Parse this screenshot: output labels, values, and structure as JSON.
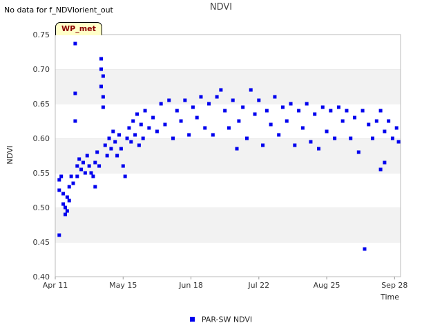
{
  "header": {
    "status_text": "No data for f_NDVIorient_out",
    "site_label": "WP_met"
  },
  "chart_data": {
    "type": "scatter",
    "title": "NDVI",
    "xlabel": "Time",
    "ylabel": "NDVI",
    "ylim": [
      0.4,
      0.75
    ],
    "xlim": [
      "2023-04-11",
      "2023-10-01"
    ],
    "y_ticks": [
      "0.40",
      "0.45",
      "0.50",
      "0.55",
      "0.60",
      "0.65",
      "0.70",
      "0.75"
    ],
    "x_ticks": [
      {
        "label": "Apr 11",
        "date": "2023-04-11"
      },
      {
        "label": "May 15",
        "date": "2023-05-15"
      },
      {
        "label": "Jun 18",
        "date": "2023-06-18"
      },
      {
        "label": "Jul 22",
        "date": "2023-07-22"
      },
      {
        "label": "Aug 25",
        "date": "2023-08-25"
      },
      {
        "label": "Sep 28",
        "date": "2023-09-28"
      }
    ],
    "grid": "alternating horizontal bands",
    "legend_position": "bottom-center",
    "series": [
      {
        "name": "PAR-SW NDVI",
        "color": "#0000ee",
        "points": [
          [
            "2023-04-13",
            0.46
          ],
          [
            "2023-04-13",
            0.54
          ],
          [
            "2023-04-13",
            0.525
          ],
          [
            "2023-04-14",
            0.545
          ],
          [
            "2023-04-15",
            0.505
          ],
          [
            "2023-04-15",
            0.52
          ],
          [
            "2023-04-16",
            0.49
          ],
          [
            "2023-04-16",
            0.5
          ],
          [
            "2023-04-17",
            0.495
          ],
          [
            "2023-04-17",
            0.515
          ],
          [
            "2023-04-18",
            0.53
          ],
          [
            "2023-04-18",
            0.51
          ],
          [
            "2023-04-19",
            0.545
          ],
          [
            "2023-04-20",
            0.535
          ],
          [
            "2023-04-21",
            0.737
          ],
          [
            "2023-04-21",
            0.665
          ],
          [
            "2023-04-21",
            0.625
          ],
          [
            "2023-04-22",
            0.56
          ],
          [
            "2023-04-22",
            0.545
          ],
          [
            "2023-04-23",
            0.57
          ],
          [
            "2023-04-24",
            0.555
          ],
          [
            "2023-04-25",
            0.565
          ],
          [
            "2023-04-26",
            0.55
          ],
          [
            "2023-04-27",
            0.575
          ],
          [
            "2023-04-28",
            0.56
          ],
          [
            "2023-04-29",
            0.55
          ],
          [
            "2023-04-30",
            0.545
          ],
          [
            "2023-05-01",
            0.53
          ],
          [
            "2023-05-01",
            0.565
          ],
          [
            "2023-05-02",
            0.58
          ],
          [
            "2023-05-03",
            0.56
          ],
          [
            "2023-05-04",
            0.715
          ],
          [
            "2023-05-04",
            0.7
          ],
          [
            "2023-05-04",
            0.675
          ],
          [
            "2023-05-05",
            0.69
          ],
          [
            "2023-05-05",
            0.66
          ],
          [
            "2023-05-05",
            0.645
          ],
          [
            "2023-05-06",
            0.59
          ],
          [
            "2023-05-07",
            0.575
          ],
          [
            "2023-05-08",
            0.6
          ],
          [
            "2023-05-09",
            0.585
          ],
          [
            "2023-05-10",
            0.61
          ],
          [
            "2023-05-11",
            0.595
          ],
          [
            "2023-05-12",
            0.575
          ],
          [
            "2023-05-13",
            0.605
          ],
          [
            "2023-05-14",
            0.585
          ],
          [
            "2023-05-15",
            0.56
          ],
          [
            "2023-05-16",
            0.545
          ],
          [
            "2023-05-17",
            0.6
          ],
          [
            "2023-05-18",
            0.615
          ],
          [
            "2023-05-19",
            0.595
          ],
          [
            "2023-05-20",
            0.625
          ],
          [
            "2023-05-21",
            0.605
          ],
          [
            "2023-05-22",
            0.635
          ],
          [
            "2023-05-23",
            0.59
          ],
          [
            "2023-05-24",
            0.62
          ],
          [
            "2023-05-25",
            0.6
          ],
          [
            "2023-05-26",
            0.64
          ],
          [
            "2023-05-28",
            0.615
          ],
          [
            "2023-05-30",
            0.63
          ],
          [
            "2023-06-01",
            0.61
          ],
          [
            "2023-06-03",
            0.65
          ],
          [
            "2023-06-05",
            0.62
          ],
          [
            "2023-06-07",
            0.655
          ],
          [
            "2023-06-09",
            0.6
          ],
          [
            "2023-06-11",
            0.64
          ],
          [
            "2023-06-13",
            0.625
          ],
          [
            "2023-06-15",
            0.655
          ],
          [
            "2023-06-17",
            0.605
          ],
          [
            "2023-06-19",
            0.645
          ],
          [
            "2023-06-21",
            0.63
          ],
          [
            "2023-06-23",
            0.66
          ],
          [
            "2023-06-25",
            0.615
          ],
          [
            "2023-06-27",
            0.65
          ],
          [
            "2023-06-29",
            0.605
          ],
          [
            "2023-07-01",
            0.66
          ],
          [
            "2023-07-03",
            0.67
          ],
          [
            "2023-07-05",
            0.64
          ],
          [
            "2023-07-07",
            0.615
          ],
          [
            "2023-07-09",
            0.655
          ],
          [
            "2023-07-11",
            0.585
          ],
          [
            "2023-07-12",
            0.625
          ],
          [
            "2023-07-14",
            0.645
          ],
          [
            "2023-07-16",
            0.6
          ],
          [
            "2023-07-18",
            0.67
          ],
          [
            "2023-07-20",
            0.635
          ],
          [
            "2023-07-22",
            0.655
          ],
          [
            "2023-07-24",
            0.59
          ],
          [
            "2023-07-26",
            0.64
          ],
          [
            "2023-07-28",
            0.62
          ],
          [
            "2023-07-30",
            0.66
          ],
          [
            "2023-08-01",
            0.605
          ],
          [
            "2023-08-03",
            0.645
          ],
          [
            "2023-08-05",
            0.625
          ],
          [
            "2023-08-07",
            0.65
          ],
          [
            "2023-08-09",
            0.59
          ],
          [
            "2023-08-11",
            0.64
          ],
          [
            "2023-08-13",
            0.615
          ],
          [
            "2023-08-15",
            0.65
          ],
          [
            "2023-08-17",
            0.595
          ],
          [
            "2023-08-19",
            0.635
          ],
          [
            "2023-08-21",
            0.585
          ],
          [
            "2023-08-23",
            0.645
          ],
          [
            "2023-08-25",
            0.61
          ],
          [
            "2023-08-27",
            0.64
          ],
          [
            "2023-08-29",
            0.6
          ],
          [
            "2023-08-31",
            0.645
          ],
          [
            "2023-09-02",
            0.625
          ],
          [
            "2023-09-04",
            0.64
          ],
          [
            "2023-09-06",
            0.6
          ],
          [
            "2023-09-08",
            0.63
          ],
          [
            "2023-09-10",
            0.58
          ],
          [
            "2023-09-12",
            0.64
          ],
          [
            "2023-09-13",
            0.44
          ],
          [
            "2023-09-15",
            0.62
          ],
          [
            "2023-09-17",
            0.6
          ],
          [
            "2023-09-19",
            0.625
          ],
          [
            "2023-09-21",
            0.64
          ],
          [
            "2023-09-21",
            0.555
          ],
          [
            "2023-09-23",
            0.61
          ],
          [
            "2023-09-23",
            0.565
          ],
          [
            "2023-09-25",
            0.625
          ],
          [
            "2023-09-27",
            0.6
          ],
          [
            "2023-09-29",
            0.615
          ],
          [
            "2023-09-30",
            0.595
          ]
        ]
      }
    ]
  }
}
